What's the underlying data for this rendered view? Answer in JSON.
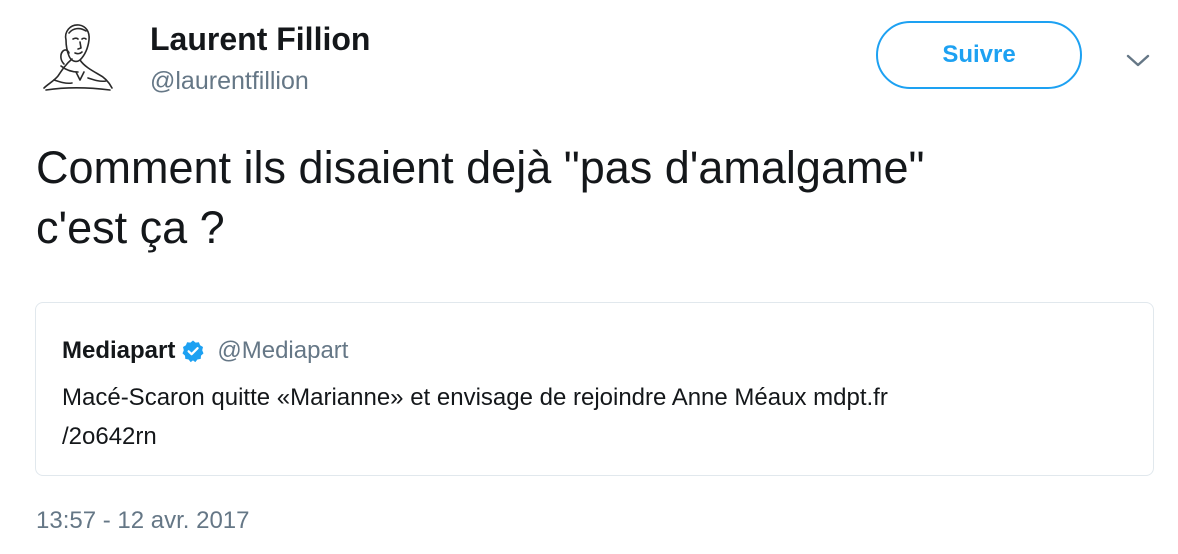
{
  "author": {
    "name": "Laurent Fillion",
    "handle": "@laurentfillion"
  },
  "follow_button": {
    "label": "Suivre"
  },
  "more_icon": "chevron-down-icon",
  "tweet": {
    "text_line_1": "Comment ils disaient dejà \"pas d'amalgame\"",
    "text_line_2": "c'est ça ?"
  },
  "quoted_tweet": {
    "name": "Mediapart",
    "verified_icon": "verified-badge-icon",
    "handle": "@Mediapart",
    "text_line_1": "Macé-Scaron quitte «Marianne» et envisage de rejoindre Anne Méaux mdpt.fr",
    "text_line_2": "/2o642rn"
  },
  "timestamp": "13:57 - 12 avr. 2017",
  "colors": {
    "accent": "#1da1f2",
    "secondary_text": "#657786",
    "primary_text": "#14171a",
    "border": "#e1e8ed"
  }
}
